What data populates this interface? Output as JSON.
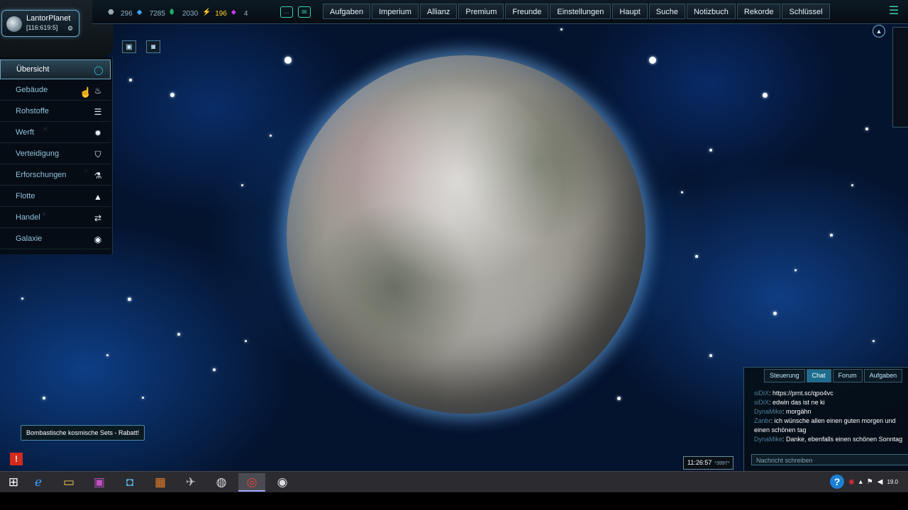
{
  "planet_selector": {
    "name": "LantorPlanet",
    "coords": "[116:619:5]"
  },
  "resources": [
    {
      "icon": "metal-icon",
      "value": "296",
      "color": "#9aa9b3"
    },
    {
      "icon": "crystal-icon",
      "value": "7285",
      "color": "#3aa7ff"
    },
    {
      "icon": "deuterium-icon",
      "value": "2030",
      "color": "#19b06a"
    },
    {
      "icon": "energy-icon",
      "value": "196",
      "color": "#ffd21a"
    },
    {
      "icon": "dark-matter-icon",
      "value": "4",
      "color": "#c93cff"
    }
  ],
  "nav": [
    "Aufgaben",
    "Imperium",
    "Allianz",
    "Premium",
    "Freunde",
    "Einstellungen",
    "Haupt",
    "Suche",
    "Notizbuch",
    "Rekorde",
    "Schlüssel"
  ],
  "sidebar": [
    {
      "label": "Übersicht",
      "icon": "overview-icon",
      "active": true
    },
    {
      "label": "Gebäude",
      "icon": "buildings-icon"
    },
    {
      "label": "Rohstoffe",
      "icon": "resources-icon"
    },
    {
      "label": "Werft",
      "icon": "shipyard-icon"
    },
    {
      "label": "Verteidigung",
      "icon": "shield-icon"
    },
    {
      "label": "Erforschungen",
      "icon": "research-icon"
    },
    {
      "label": "Flotte",
      "icon": "fleet-icon"
    },
    {
      "label": "Handel",
      "icon": "trade-icon"
    },
    {
      "label": "Galaxie",
      "icon": "galaxy-icon"
    }
  ],
  "promo": "Bombastische kosmische Sets - Rabatt!",
  "clock": {
    "time": "11:26:57",
    "zone": "*3997*"
  },
  "chat": {
    "tabs": [
      "Steuerung",
      "Chat",
      "Forum",
      "Aufgaben"
    ],
    "active_tab": "Chat",
    "messages": [
      {
        "name": "siDiX",
        "text": "https://prnt.sc/qpo4vc"
      },
      {
        "name": "siDiX",
        "text": "edwin das ist ne ki"
      },
      {
        "name": "DynaMike",
        "text": "morgähn"
      },
      {
        "name": "Zanbr",
        "text": "ich wünsche allen einen guten morgen und einen schönen tag"
      },
      {
        "name": "DynaMike",
        "text": "Danke, ebenfalls einen schönen Sonntag"
      }
    ],
    "input_placeholder": "Nachricht schreiben"
  },
  "taskbar": [
    "windows-start-icon",
    "internet-explorer-icon",
    "file-explorer-icon",
    "media-app-icon",
    "camera-app-icon",
    "paint-app-icon",
    "game-app-icon",
    "palette-app-icon",
    "chrome-icon",
    "obs-icon"
  ],
  "tray_date": "19.0"
}
